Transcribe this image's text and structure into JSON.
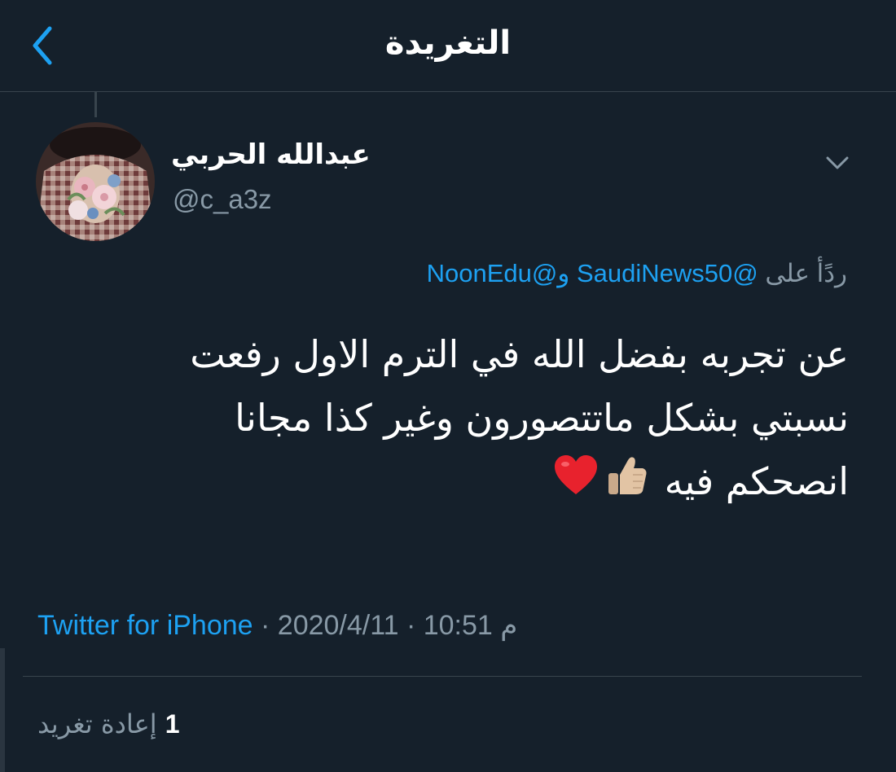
{
  "header": {
    "title": "التغريدة",
    "back_icon": "chevron-left-icon"
  },
  "tweet": {
    "author": {
      "display_name": "عبدالله الحربي",
      "handle": "@c_a3z"
    },
    "reply_to": {
      "prefix": "ردًأ على",
      "mention1": "@SaudiNews50",
      "conjunction": "و",
      "mention2": "@NoonEdu"
    },
    "text_lines": [
      "عن تجربه بفضل الله في الترم الاول رفعت",
      "نسبتي بشكل ماتتصورون وغير كذا مجانا",
      "انصحكم فيه"
    ],
    "emojis": [
      "thumbs-up-icon",
      "heart-icon"
    ],
    "meta": {
      "time": "10:51 م",
      "separator": " · ",
      "date": "2020/4/11",
      "source": "Twitter for iPhone"
    },
    "stats": {
      "retweet_count": "1",
      "retweet_label": "إعادة تغريد"
    }
  },
  "colors": {
    "background": "#15202b",
    "accent": "#1da1f2",
    "secondary_text": "#8899a6",
    "divider": "#38444d"
  }
}
